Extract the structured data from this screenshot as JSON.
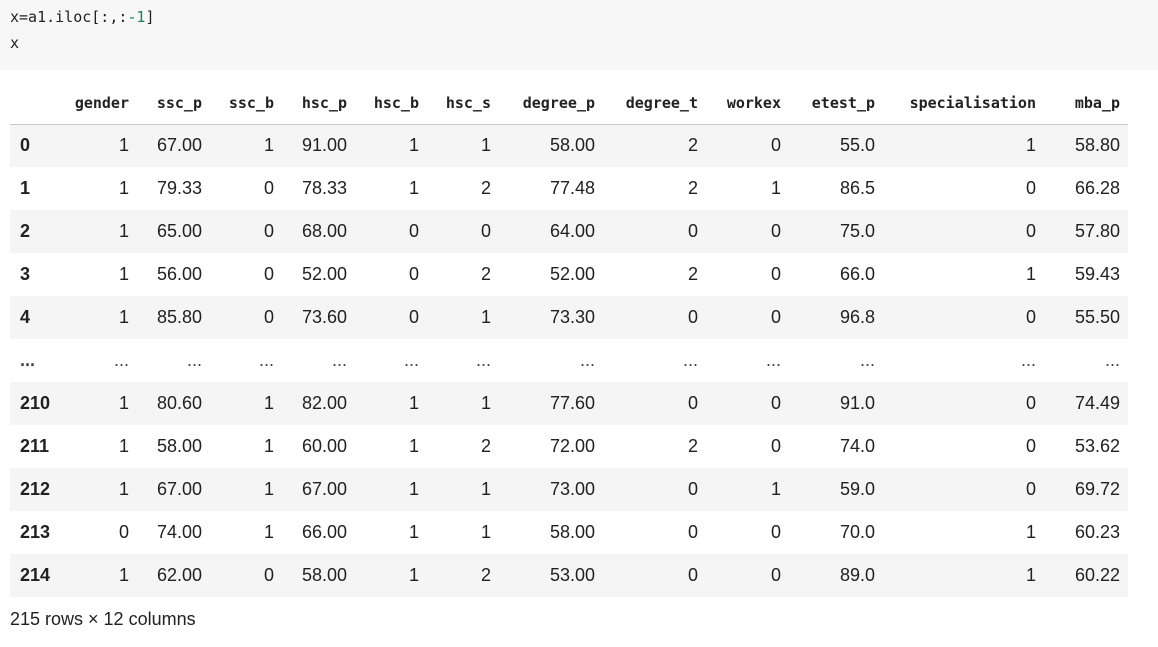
{
  "code": {
    "line1_prefix": "x=a1.iloc[:,:",
    "line1_num": "-1",
    "line1_suffix": "]",
    "line2": "x"
  },
  "table": {
    "columns": [
      "gender",
      "ssc_p",
      "ssc_b",
      "hsc_p",
      "hsc_b",
      "hsc_s",
      "degree_p",
      "degree_t",
      "workex",
      "etest_p",
      "specialisation",
      "mba_p"
    ],
    "rows": [
      {
        "index": "0",
        "cells": [
          "1",
          "67.00",
          "1",
          "91.00",
          "1",
          "1",
          "58.00",
          "2",
          "0",
          "55.0",
          "1",
          "58.80"
        ]
      },
      {
        "index": "1",
        "cells": [
          "1",
          "79.33",
          "0",
          "78.33",
          "1",
          "2",
          "77.48",
          "2",
          "1",
          "86.5",
          "0",
          "66.28"
        ]
      },
      {
        "index": "2",
        "cells": [
          "1",
          "65.00",
          "0",
          "68.00",
          "0",
          "0",
          "64.00",
          "0",
          "0",
          "75.0",
          "0",
          "57.80"
        ]
      },
      {
        "index": "3",
        "cells": [
          "1",
          "56.00",
          "0",
          "52.00",
          "0",
          "2",
          "52.00",
          "2",
          "0",
          "66.0",
          "1",
          "59.43"
        ]
      },
      {
        "index": "4",
        "cells": [
          "1",
          "85.80",
          "0",
          "73.60",
          "0",
          "1",
          "73.30",
          "0",
          "0",
          "96.8",
          "0",
          "55.50"
        ]
      },
      {
        "index": "...",
        "cells": [
          "...",
          "...",
          "...",
          "...",
          "...",
          "...",
          "...",
          "...",
          "...",
          "...",
          "...",
          "..."
        ]
      },
      {
        "index": "210",
        "cells": [
          "1",
          "80.60",
          "1",
          "82.00",
          "1",
          "1",
          "77.60",
          "0",
          "0",
          "91.0",
          "0",
          "74.49"
        ]
      },
      {
        "index": "211",
        "cells": [
          "1",
          "58.00",
          "1",
          "60.00",
          "1",
          "2",
          "72.00",
          "2",
          "0",
          "74.0",
          "0",
          "53.62"
        ]
      },
      {
        "index": "212",
        "cells": [
          "1",
          "67.00",
          "1",
          "67.00",
          "1",
          "1",
          "73.00",
          "0",
          "1",
          "59.0",
          "0",
          "69.72"
        ]
      },
      {
        "index": "213",
        "cells": [
          "0",
          "74.00",
          "1",
          "66.00",
          "1",
          "1",
          "58.00",
          "0",
          "0",
          "70.0",
          "1",
          "60.23"
        ]
      },
      {
        "index": "214",
        "cells": [
          "1",
          "62.00",
          "0",
          "58.00",
          "1",
          "2",
          "53.00",
          "0",
          "0",
          "89.0",
          "1",
          "60.22"
        ]
      }
    ]
  },
  "footer": "215 rows × 12 columns"
}
